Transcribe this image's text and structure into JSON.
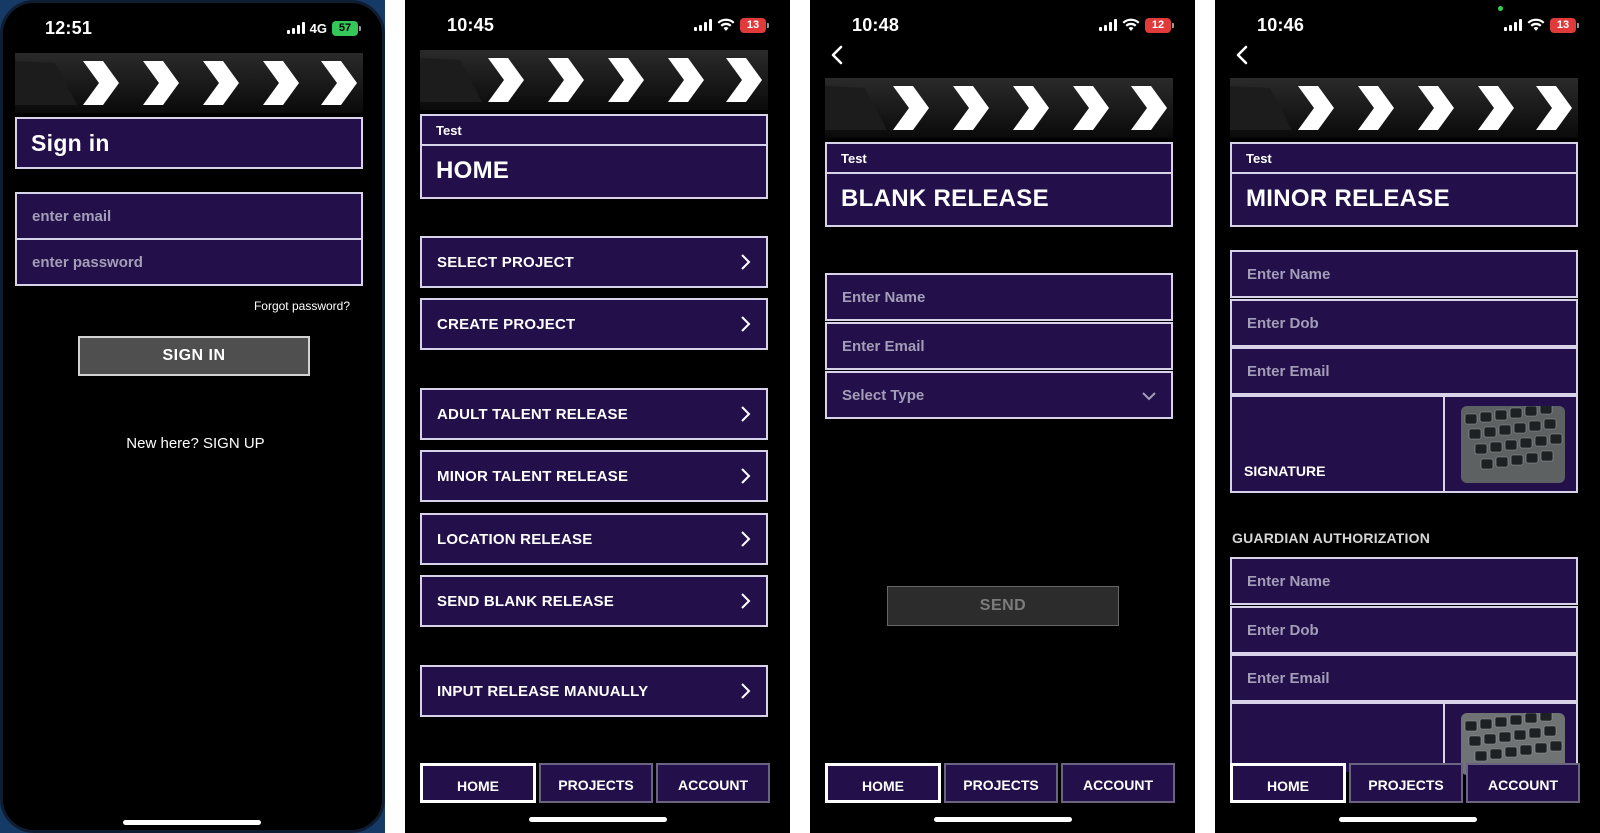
{
  "screens": [
    {
      "status": {
        "time": "12:51",
        "network": "4G",
        "battery": "57"
      },
      "title": "Sign in",
      "email_placeholder": "enter email",
      "password_placeholder": "enter password",
      "forgot_password": "Forgot password?",
      "signin_button": "SIGN IN",
      "signup_text": "New here? SIGN UP"
    },
    {
      "status": {
        "time": "10:45",
        "battery": "13"
      },
      "project": "Test",
      "title": "HOME",
      "menu": [
        "SELECT PROJECT",
        "CREATE PROJECT",
        "ADULT TALENT RELEASE",
        "MINOR TALENT RELEASE",
        "LOCATION RELEASE",
        "SEND BLANK RELEASE",
        "INPUT RELEASE MANUALLY"
      ]
    },
    {
      "status": {
        "time": "10:48",
        "battery": "12"
      },
      "project": "Test",
      "title": "BLANK RELEASE",
      "name_placeholder": "Enter Name",
      "email_placeholder": "Enter Email",
      "type_placeholder": "Select Type",
      "send_button": "SEND"
    },
    {
      "status": {
        "time": "10:46",
        "battery": "13"
      },
      "project": "Test",
      "title": "MINOR RELEASE",
      "minor_fields": [
        "Enter Name",
        "Enter Dob",
        "Enter Email"
      ],
      "signature_label": "SIGNATURE",
      "guardian_section": "GUARDIAN AUTHORIZATION",
      "guardian_fields": [
        "Enter Name",
        "Enter Dob",
        "Enter Email"
      ]
    }
  ],
  "tabbar": [
    "HOME",
    "PROJECTS",
    "ACCOUNT"
  ],
  "colors": {
    "panel": "#23104a",
    "border": "#d9d3ea",
    "background": "#000000"
  }
}
